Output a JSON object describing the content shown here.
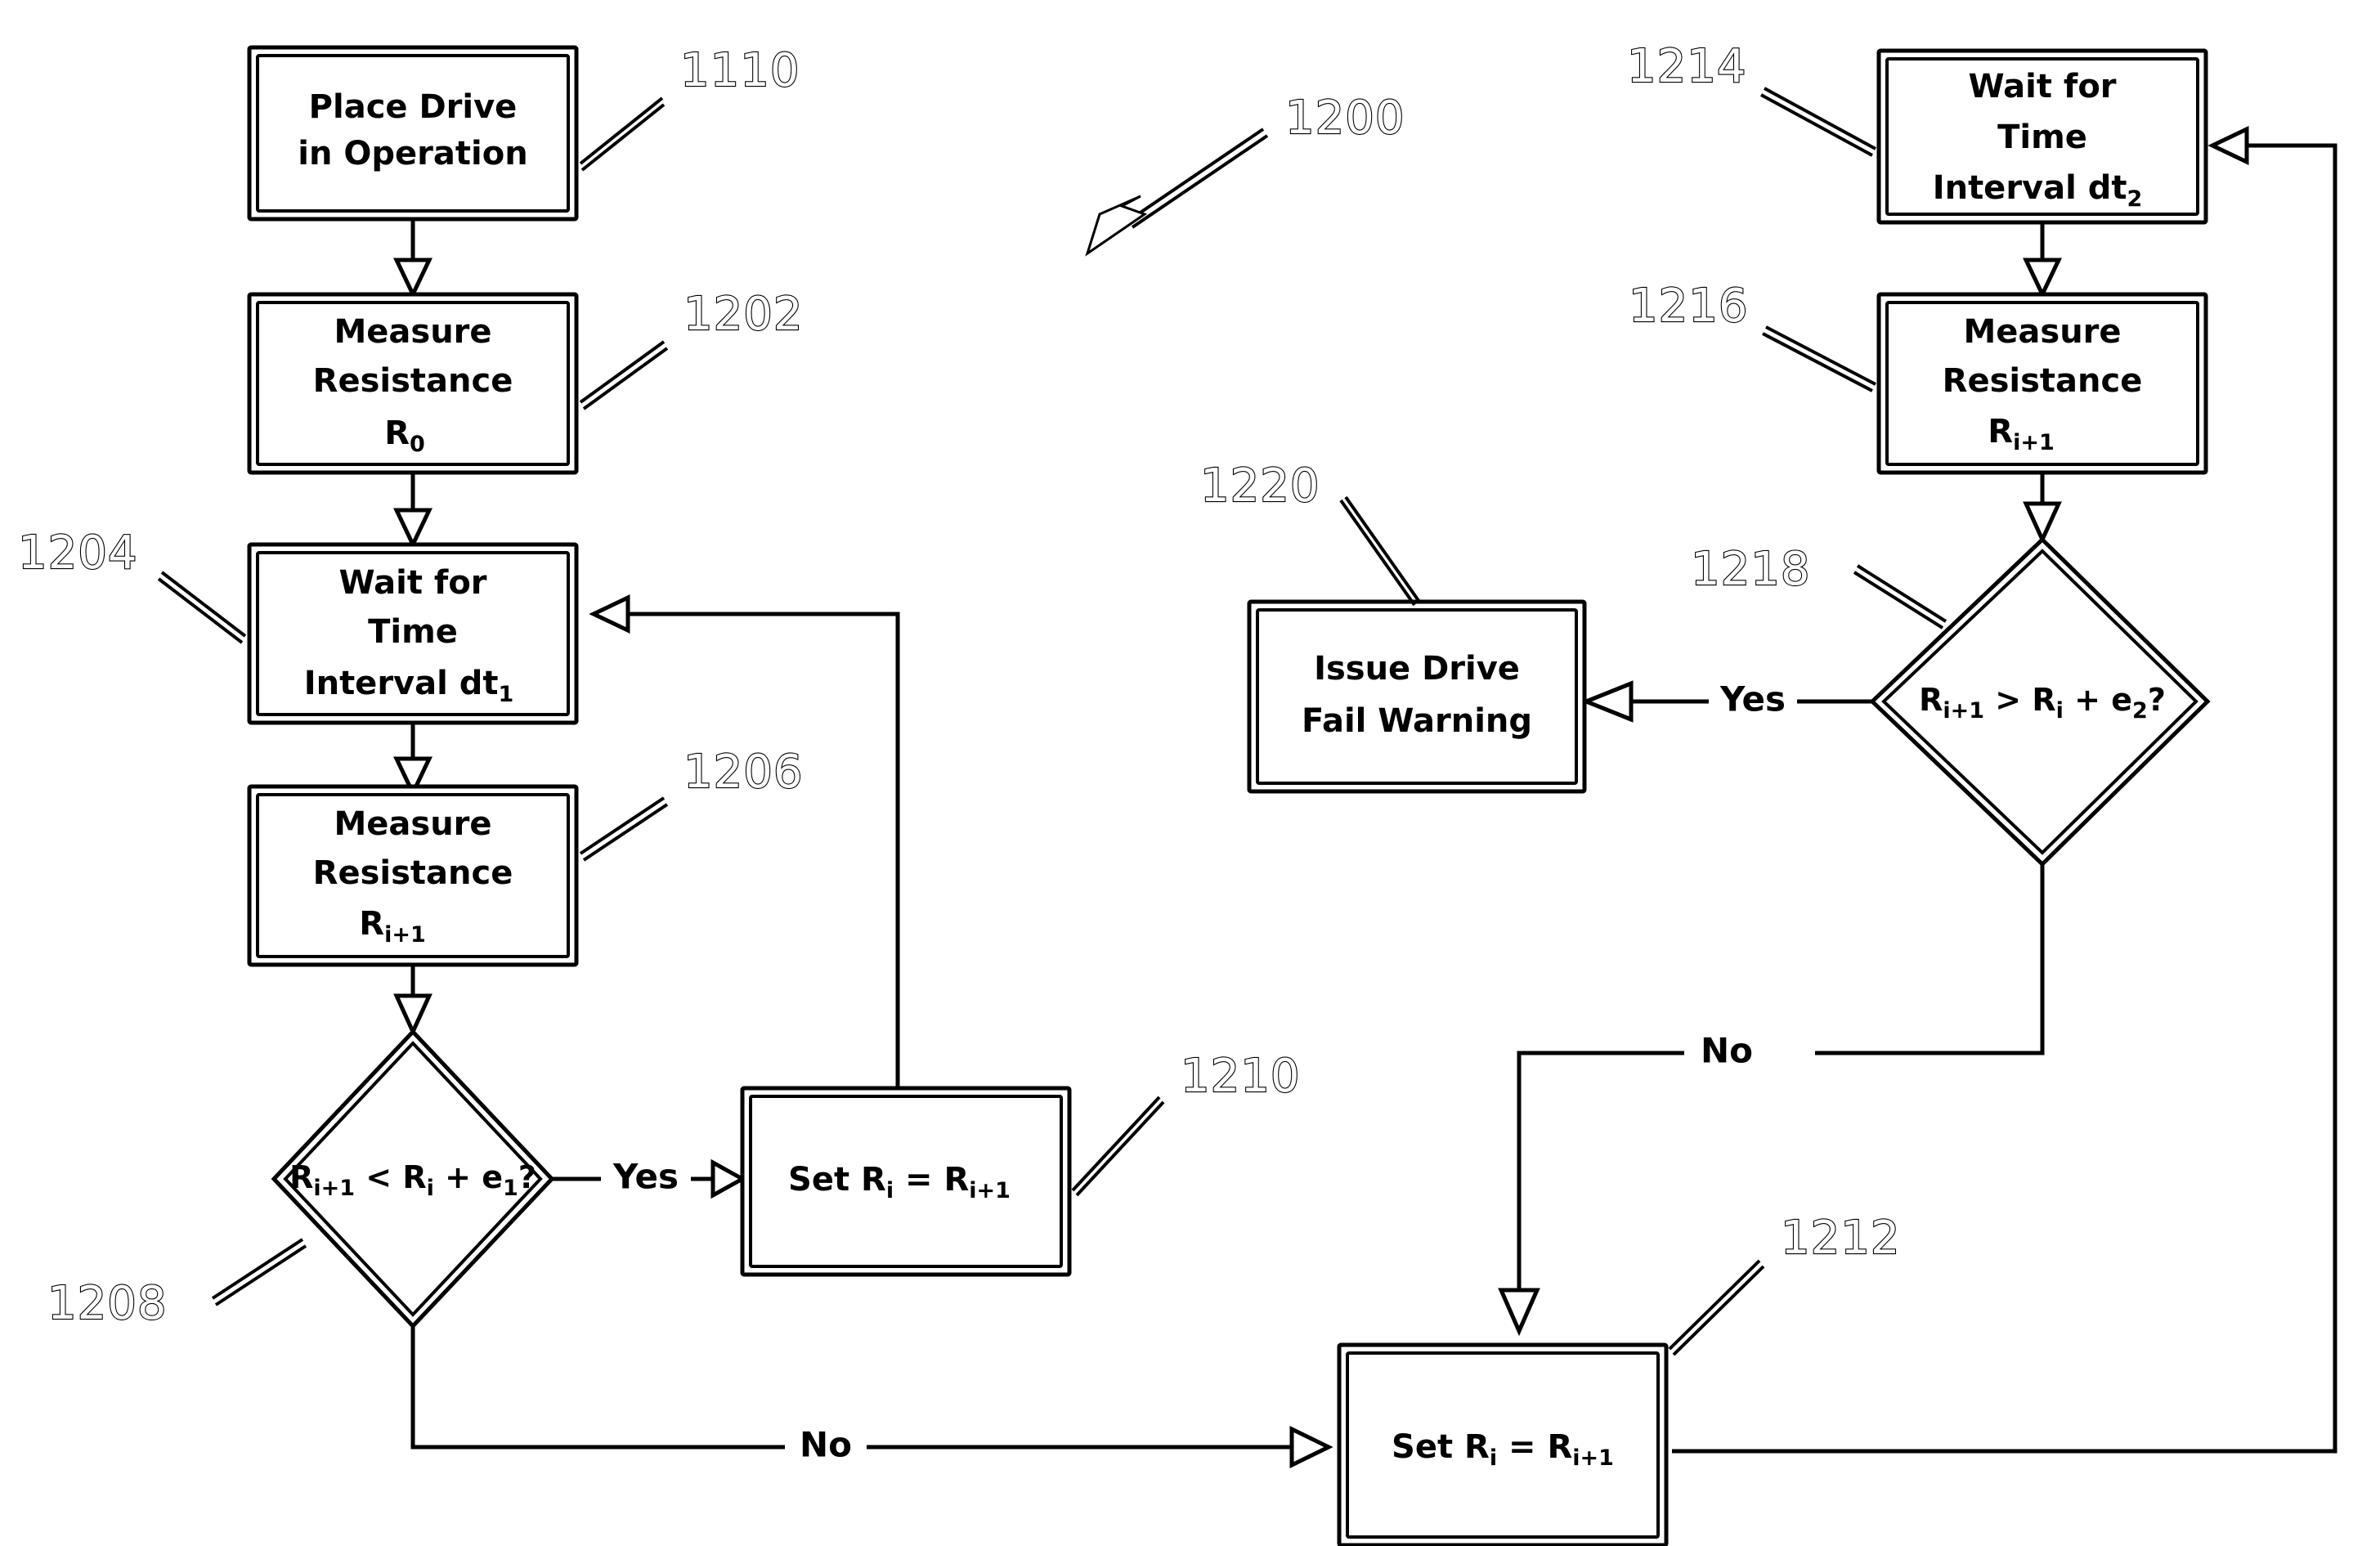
{
  "figure": {
    "reference": "1200",
    "type": "flowchart",
    "title": "Drive resistance monitoring flowchart"
  },
  "nodes": {
    "place_drive": {
      "ref": "1110",
      "shape": "process",
      "lines": [
        "Place Drive",
        "in Operation"
      ]
    },
    "measure_r0": {
      "ref": "1202",
      "shape": "process",
      "lines": [
        "Measure",
        "Resistance",
        "R"
      ],
      "subscript": "0"
    },
    "wait_dt1": {
      "ref": "1204",
      "shape": "process",
      "lines": [
        "Wait for",
        "Time",
        "Interval dt"
      ],
      "subscript": "1"
    },
    "measure_ri1_left": {
      "ref": "1206",
      "shape": "process",
      "lines": [
        "Measure",
        "Resistance",
        "R"
      ],
      "subscript": "i+1"
    },
    "decision_e1": {
      "ref": "1208",
      "shape": "decision",
      "text": "R_{i+1} < R_i + e_1?",
      "parts": [
        {
          "base": "R",
          "sub": "i+1"
        },
        {
          "base": " < "
        },
        {
          "base": "R",
          "sub": "i"
        },
        {
          "base": " + "
        },
        {
          "base": "e",
          "sub": "1"
        },
        {
          "base": "?"
        }
      ]
    },
    "set_ri_1210": {
      "ref": "1210",
      "shape": "process",
      "text": "Set R_i = R_{i+1}",
      "parts": [
        {
          "base": "Set "
        },
        {
          "base": "R",
          "sub": "i"
        },
        {
          "base": " = "
        },
        {
          "base": "R",
          "sub": "i+1"
        }
      ]
    },
    "set_ri_1212": {
      "ref": "1212",
      "shape": "process",
      "text": "Set R_i = R_{i+1}",
      "parts": [
        {
          "base": "Set "
        },
        {
          "base": "R",
          "sub": "i"
        },
        {
          "base": " = "
        },
        {
          "base": "R",
          "sub": "i+1"
        }
      ]
    },
    "wait_dt2": {
      "ref": "1214",
      "shape": "process",
      "lines": [
        "Wait for",
        "Time",
        "Interval dt"
      ],
      "subscript": "2"
    },
    "measure_ri1_right": {
      "ref": "1216",
      "shape": "process",
      "lines": [
        "Measure",
        "Resistance",
        "R"
      ],
      "subscript": "i+1"
    },
    "decision_e2": {
      "ref": "1218",
      "shape": "decision",
      "text": "R_{i+1} > R_i + e_2?",
      "parts": [
        {
          "base": "R",
          "sub": "i+1"
        },
        {
          "base": " > "
        },
        {
          "base": "R",
          "sub": "i"
        },
        {
          "base": " + "
        },
        {
          "base": "e",
          "sub": "2"
        },
        {
          "base": "?"
        }
      ]
    },
    "issue_warning": {
      "ref": "1220",
      "shape": "process",
      "lines": [
        "Issue Drive",
        "Fail Warning"
      ]
    }
  },
  "edge_labels": {
    "yes_1208": "Yes",
    "no_1208": "No",
    "yes_1218": "Yes",
    "no_1218": "No"
  },
  "ref_numbers": {
    "r1110": "1110",
    "r1200": "1200",
    "r1202": "1202",
    "r1204": "1204",
    "r1206": "1206",
    "r1208": "1208",
    "r1210": "1210",
    "r1212": "1212",
    "r1214": "1214",
    "r1216": "1216",
    "r1218": "1218",
    "r1220": "1220"
  },
  "colors": {
    "stroke": "#000000",
    "fill": "#ffffff",
    "background": "#ffffff"
  }
}
